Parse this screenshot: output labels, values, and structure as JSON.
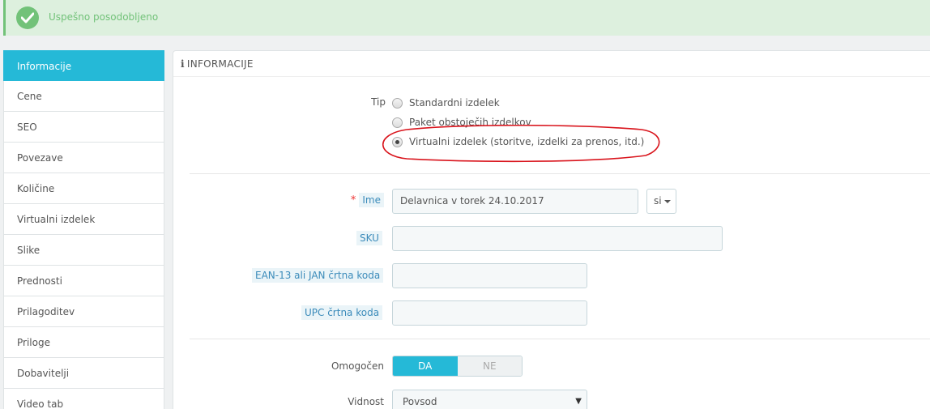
{
  "alert": {
    "message": "Uspešno posodobljeno",
    "icon": "check-circle-icon",
    "color": "#72c279"
  },
  "sidebar": {
    "items": [
      {
        "label": "Informacije",
        "active": true
      },
      {
        "label": "Cene"
      },
      {
        "label": "SEO"
      },
      {
        "label": "Povezave"
      },
      {
        "label": "Količine"
      },
      {
        "label": "Virtualni izdelek"
      },
      {
        "label": "Slike"
      },
      {
        "label": "Prednosti"
      },
      {
        "label": "Prilagoditev"
      },
      {
        "label": "Priloge"
      },
      {
        "label": "Dobavitelji"
      },
      {
        "label": "Video tab"
      }
    ]
  },
  "panel": {
    "title": "INFORMACIJE",
    "type": {
      "label": "Tip",
      "options": [
        {
          "label": "Standardni izdelek",
          "checked": false
        },
        {
          "label": "Paket obstoječih izdelkov",
          "checked": false
        },
        {
          "label": "Virtualni izdelek (storitve, izdelki za prenos, itd.)",
          "checked": true
        }
      ]
    },
    "name": {
      "label": "Ime",
      "required": "*",
      "value": "Delavnica v torek 24.10.2017",
      "lang": "si"
    },
    "sku": {
      "label": "SKU",
      "value": ""
    },
    "ean": {
      "label": "EAN-13 ali JAN črtna koda",
      "value": ""
    },
    "upc": {
      "label": "UPC črtna koda",
      "value": ""
    },
    "enabled": {
      "label": "Omogočen",
      "yes": "DA",
      "no": "NE",
      "value": "DA"
    },
    "visibility": {
      "label": "Vidnost",
      "value": "Povsod"
    }
  },
  "colors": {
    "accent": "#25b9d7",
    "annotation": "#d9141c"
  }
}
